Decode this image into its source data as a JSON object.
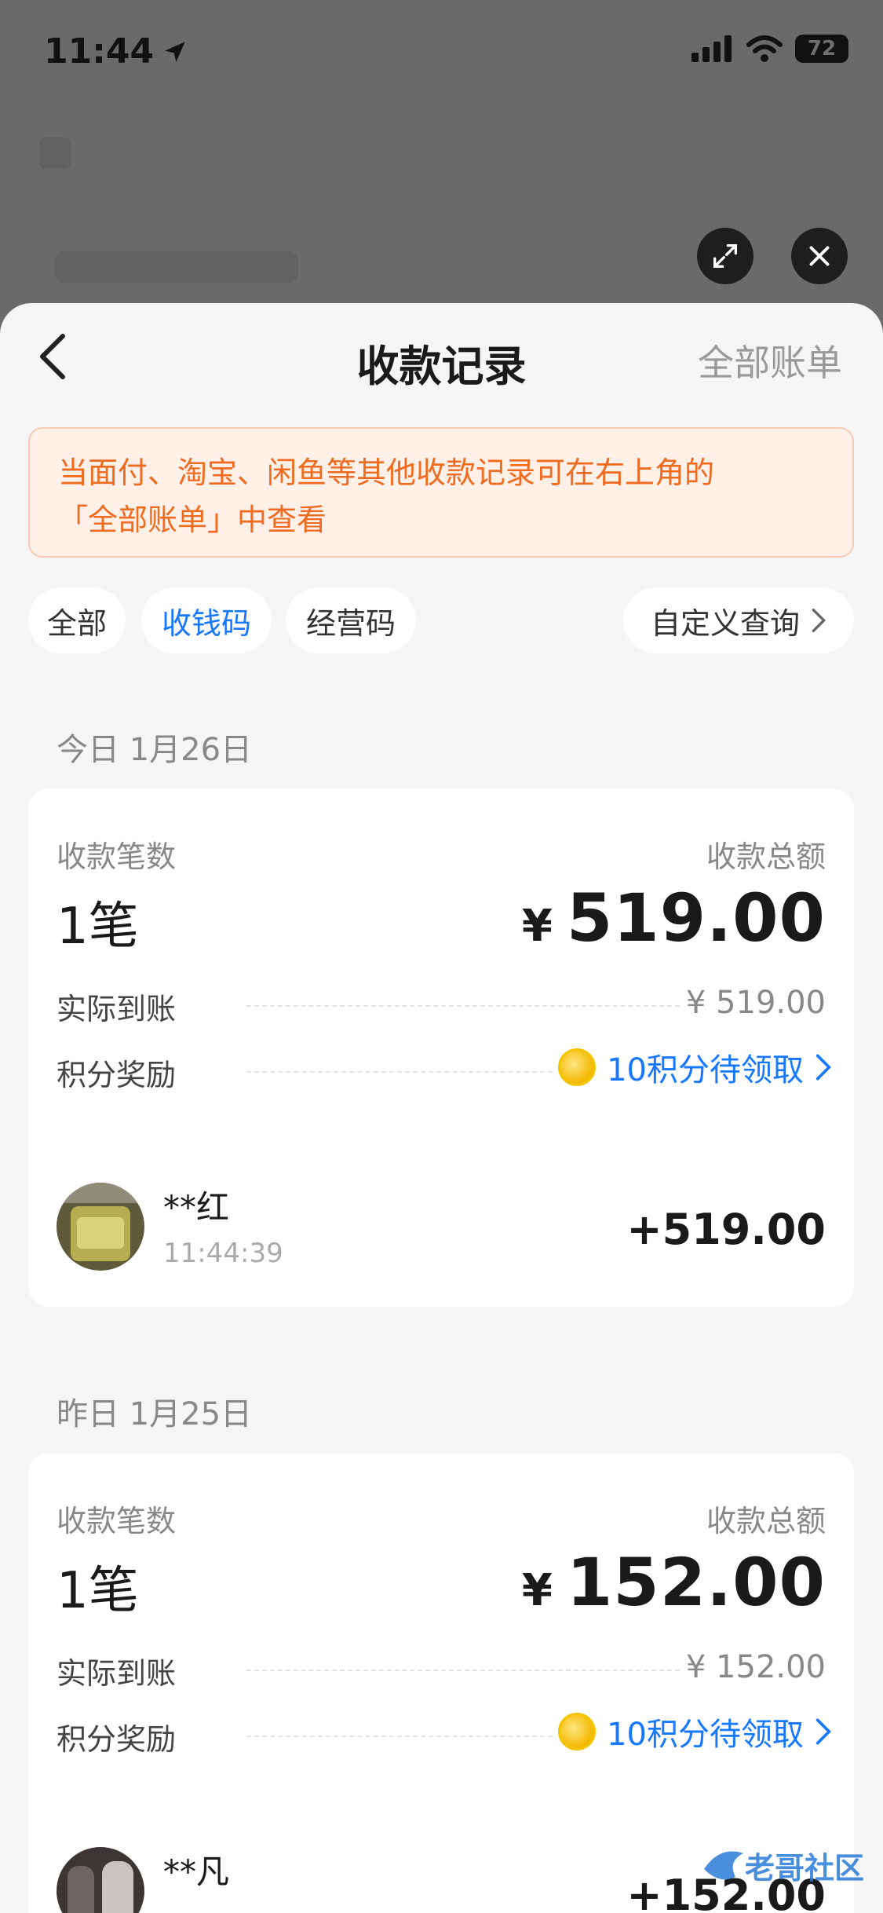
{
  "status_bar": {
    "time": "11:44",
    "battery": "72"
  },
  "header": {
    "title": "收款记录",
    "all_bills": "全部账单"
  },
  "notice": {
    "line1": "当面付、淘宝、闲鱼等其他收款记录可在右上角的",
    "line2": "「全部账单」中查看"
  },
  "filters": {
    "items": [
      {
        "label": "全部",
        "active": false
      },
      {
        "label": "收钱码",
        "active": true
      },
      {
        "label": "经营码",
        "active": false
      }
    ],
    "custom_query": "自定义查询"
  },
  "days": [
    {
      "date": "今日 1月26日",
      "count_label": "收款笔数",
      "count": "1笔",
      "total_label": "收款总额",
      "total_currency": "¥",
      "total": "519.00",
      "actual_label": "实际到账",
      "actual": "¥ 519.00",
      "reward_label": "积分奖励",
      "reward_text": "10积分待领取",
      "payer": {
        "name": "**红",
        "time": "11:44:39",
        "amount": "+519.00"
      }
    },
    {
      "date": "昨日 1月25日",
      "count_label": "收款笔数",
      "count": "1笔",
      "total_label": "收款总额",
      "total_currency": "¥",
      "total": "152.00",
      "actual_label": "实际到账",
      "actual": "¥ 152.00",
      "reward_label": "积分奖励",
      "reward_text": "10积分待领取",
      "payer": {
        "name": "**凡",
        "time": "",
        "amount": "+152.00"
      }
    }
  ],
  "watermark": {
    "text": "老哥社区"
  },
  "colors": {
    "accent": "#1677ff",
    "notice_text": "#f06a1f",
    "notice_bg": "#fff0e8"
  }
}
